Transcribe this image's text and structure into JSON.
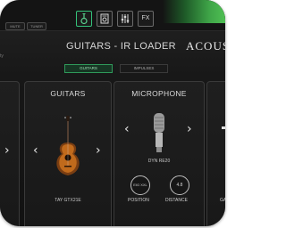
{
  "topbar": {
    "mode_buttons": [
      "MUTE",
      "TUNER"
    ],
    "tool_icons": [
      "guitar-icon",
      "amp-icon",
      "mixer-icon",
      "fx-icon"
    ],
    "fx_label": "FX"
  },
  "header": {
    "title": "GUITARS - IR LOADER",
    "brand": "ACOUST",
    "side_text": "ty"
  },
  "tabs": [
    {
      "label": "GUITARS",
      "active": true
    },
    {
      "label": "IMPULSES",
      "active": false
    }
  ],
  "guitars_panel": {
    "title": "GUITARS",
    "selected": "TAY GTX21E"
  },
  "microphone_panel": {
    "title": "MICROPHONE",
    "selected": "DYN RE20",
    "position_label": "POSITION",
    "position_value": "EIG XXL",
    "distance_label": "DISTANCE",
    "distance_value": "4.8"
  },
  "right_panel": {
    "label": "GA"
  }
}
